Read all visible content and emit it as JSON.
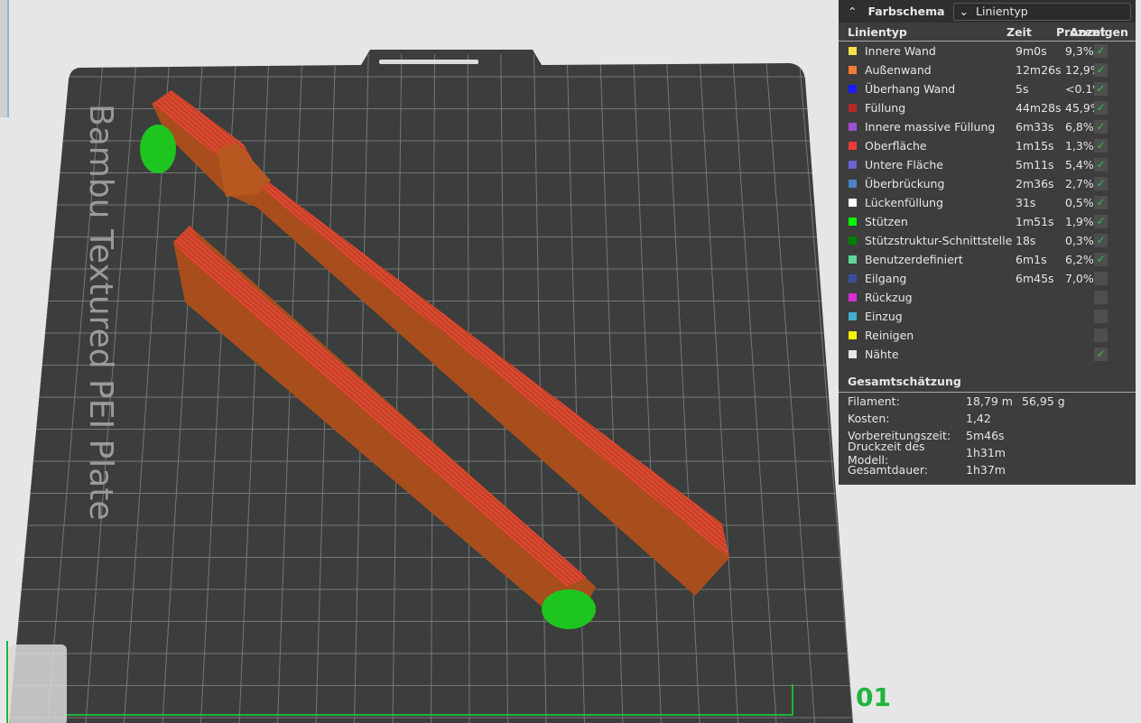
{
  "panel": {
    "title": "Farbschema",
    "scheme_select": "Linientyp",
    "columns": {
      "type": "Linientyp",
      "time": "Zeit",
      "percent": "Prozent",
      "show": "Anzeigen"
    },
    "rows": [
      {
        "name": "Innere Wand",
        "time": "9m0s",
        "percent": "9,3%",
        "color": "#f6e045",
        "shown": true
      },
      {
        "name": "Außenwand",
        "time": "12m26s",
        "percent": "12,9%",
        "color": "#f47a32",
        "shown": true
      },
      {
        "name": "Überhang Wand",
        "time": "5s",
        "percent": "<0.1%",
        "color": "#1a1aff",
        "shown": true
      },
      {
        "name": "Füllung",
        "time": "44m28s",
        "percent": "45,9%",
        "color": "#b22a2a",
        "shown": true
      },
      {
        "name": "Innere massive Füllung",
        "time": "6m33s",
        "percent": "6,8%",
        "color": "#9a4fd0",
        "shown": true
      },
      {
        "name": "Oberfläche",
        "time": "1m15s",
        "percent": "1,3%",
        "color": "#f03a3a",
        "shown": true
      },
      {
        "name": "Untere Fläche",
        "time": "5m11s",
        "percent": "5,4%",
        "color": "#6a63d0",
        "shown": true
      },
      {
        "name": "Überbrückung",
        "time": "2m36s",
        "percent": "2,7%",
        "color": "#4d84c8",
        "shown": true
      },
      {
        "name": "Lückenfüllung",
        "time": "31s",
        "percent": "0,5%",
        "color": "#ffffff",
        "shown": true
      },
      {
        "name": "Stützen",
        "time": "1m51s",
        "percent": "1,9%",
        "color": "#00ff00",
        "shown": true
      },
      {
        "name": "Stützstruktur-Schnittstelle",
        "time": "18s",
        "percent": "0,3%",
        "color": "#008000",
        "shown": true
      },
      {
        "name": "Benutzerdefiniert",
        "time": "6m1s",
        "percent": "6,2%",
        "color": "#5ed696",
        "shown": true
      },
      {
        "name": "Eilgang",
        "time": "6m45s",
        "percent": "7,0%",
        "color": "#3a4ea0",
        "shown": false
      },
      {
        "name": "Rückzug",
        "time": "",
        "percent": "",
        "color": "#d42ed4",
        "shown": false
      },
      {
        "name": "Einzug",
        "time": "",
        "percent": "",
        "color": "#44aed0",
        "shown": false
      },
      {
        "name": "Reinigen",
        "time": "",
        "percent": "",
        "color": "#f6f600",
        "shown": false
      },
      {
        "name": "Nähte",
        "time": "",
        "percent": "",
        "color": "#e6e6e6",
        "shown": true
      }
    ],
    "summary_title": "Gesamtschätzung",
    "summary": [
      {
        "label": "Filament:",
        "value": "18,79 m",
        "value2": "56,95 g"
      },
      {
        "label": "Kosten:",
        "value": "1,42",
        "value2": ""
      },
      {
        "label": "Vorbereitungszeit:",
        "value": "5m46s",
        "value2": ""
      },
      {
        "label": "Druckzeit des Modell:",
        "value": "1h31m",
        "value2": ""
      },
      {
        "label": "Gesamtdauer:",
        "value": "1h37m",
        "value2": ""
      }
    ]
  },
  "plate": {
    "label": "Bambu Textured PEI Plate",
    "number": "01"
  }
}
